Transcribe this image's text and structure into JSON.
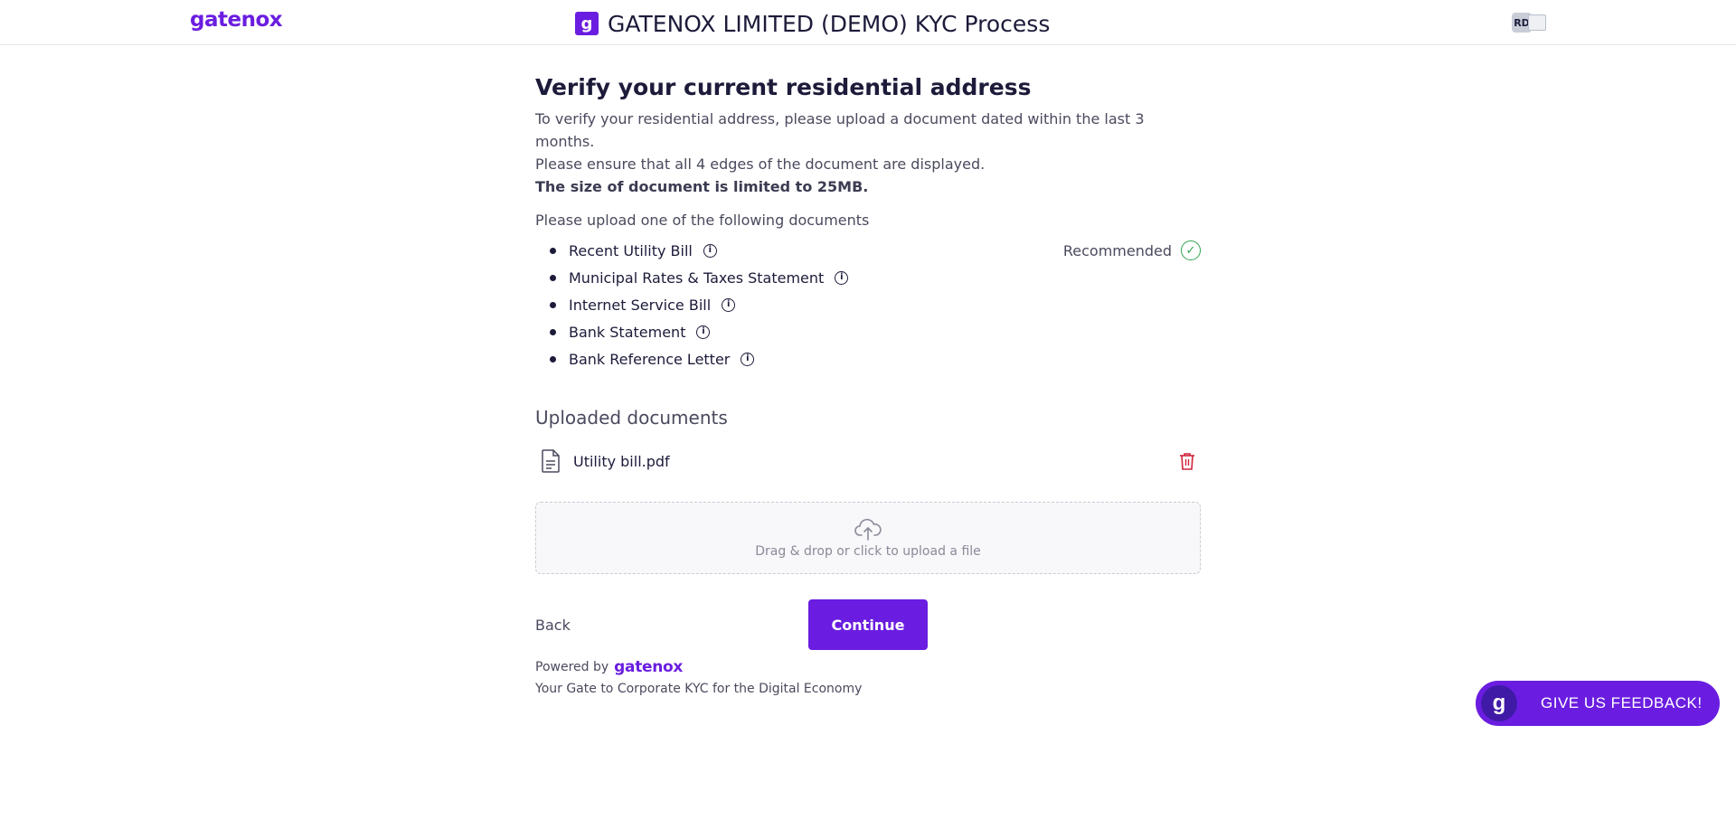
{
  "header": {
    "logo_text": "gatenox",
    "brand_icon_letter": "g",
    "title": "GATENOX LIMITED (DEMO) KYC Process",
    "avatar_initials": "RD"
  },
  "main": {
    "title": "Verify your current residential address",
    "intro_line1": "To verify your residential address, please upload a document dated within the last 3 months.",
    "intro_line2": "Please ensure that all 4 edges of the document are displayed.",
    "intro_line3": "The size of document is limited to 25MB.",
    "documents_heading": "Please upload one of the following documents",
    "documents": [
      {
        "label": "Recent Utility Bill"
      },
      {
        "label": "Municipal Rates & Taxes Statement"
      },
      {
        "label": "Internet Service Bill"
      },
      {
        "label": "Bank Statement"
      },
      {
        "label": "Bank Reference Letter"
      }
    ],
    "recommended_label": "Recommended",
    "uploaded_heading": "Uploaded documents",
    "uploaded_files": [
      {
        "name": "Utility bill.pdf"
      }
    ],
    "dropzone_text": "Drag & drop or click to upload a file",
    "back_label": "Back",
    "continue_label": "Continue"
  },
  "footer": {
    "powered_by": "Powered by",
    "logo_text": "gatenox",
    "tagline": "Your Gate to Corporate KYC for the Digital Economy"
  },
  "feedback": {
    "logo_letter": "g",
    "label": "GIVE US FEEDBACK!"
  },
  "colors": {
    "brand": "#6a1de0",
    "success": "#2ea44f",
    "danger": "#d0243a"
  }
}
